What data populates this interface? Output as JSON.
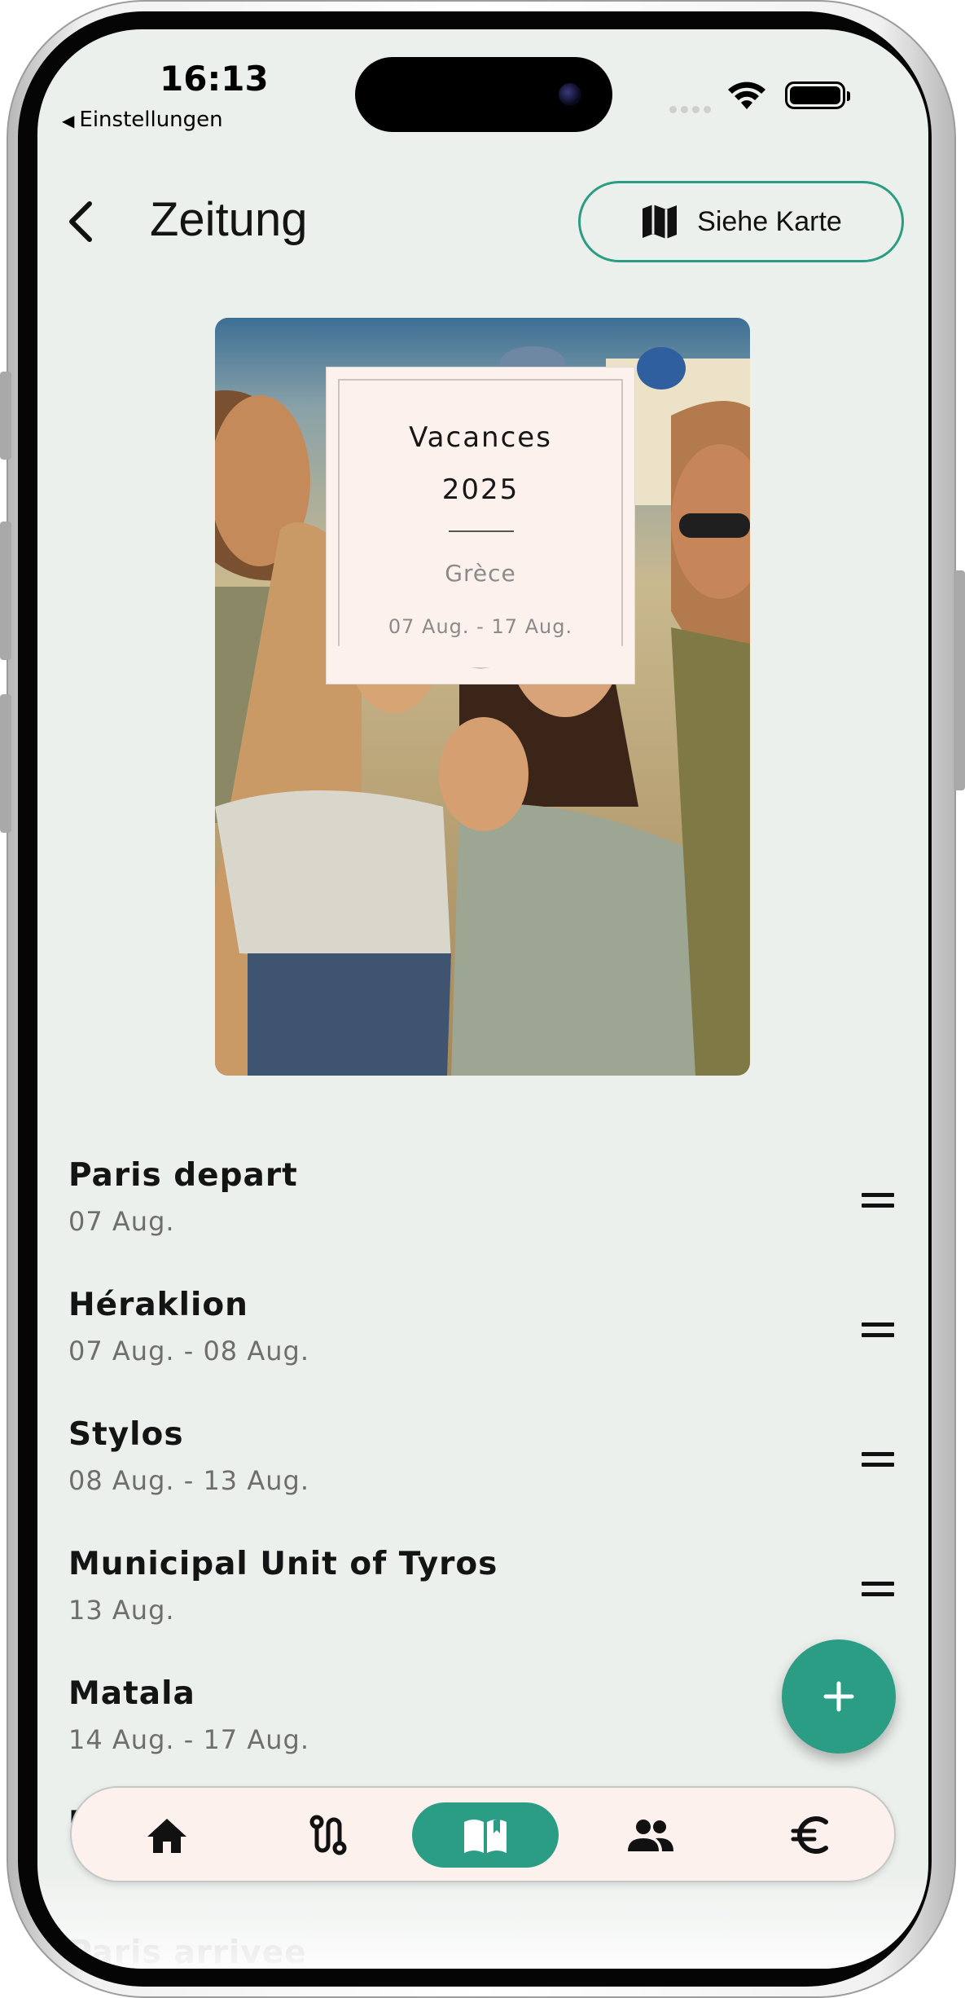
{
  "status_bar": {
    "time": "16:13",
    "back_app": "Einstellungen"
  },
  "header": {
    "title": "Zeitung",
    "map_button_label": "Siehe Karte"
  },
  "cover": {
    "title_line1": "Vacances",
    "title_line2": "2025",
    "country": "Grèce",
    "date_range": "07 Aug. - 17 Aug."
  },
  "stops": [
    {
      "name": "Paris depart",
      "dates": "07 Aug."
    },
    {
      "name": "Héraklion",
      "dates": "07 Aug. - 08 Aug."
    },
    {
      "name": "Stylos",
      "dates": "08 Aug. - 13 Aug."
    },
    {
      "name": "Municipal Unit of Tyros",
      "dates": "13 Aug."
    },
    {
      "name": "Matala",
      "dates": "14 Aug. - 17 Aug."
    },
    {
      "name": "Hé",
      "dates": ""
    },
    {
      "name": "Paris arrivee",
      "dates": ""
    }
  ],
  "bottom_nav": {
    "items": [
      {
        "icon": "home-icon",
        "active": false
      },
      {
        "icon": "route-icon",
        "active": false
      },
      {
        "icon": "journal-book-icon",
        "active": true
      },
      {
        "icon": "people-icon",
        "active": false
      },
      {
        "icon": "euro-icon",
        "active": false
      }
    ]
  },
  "colors": {
    "accent": "#2a9d84",
    "background": "#ecf0ed",
    "card": "#fdf1ee"
  }
}
